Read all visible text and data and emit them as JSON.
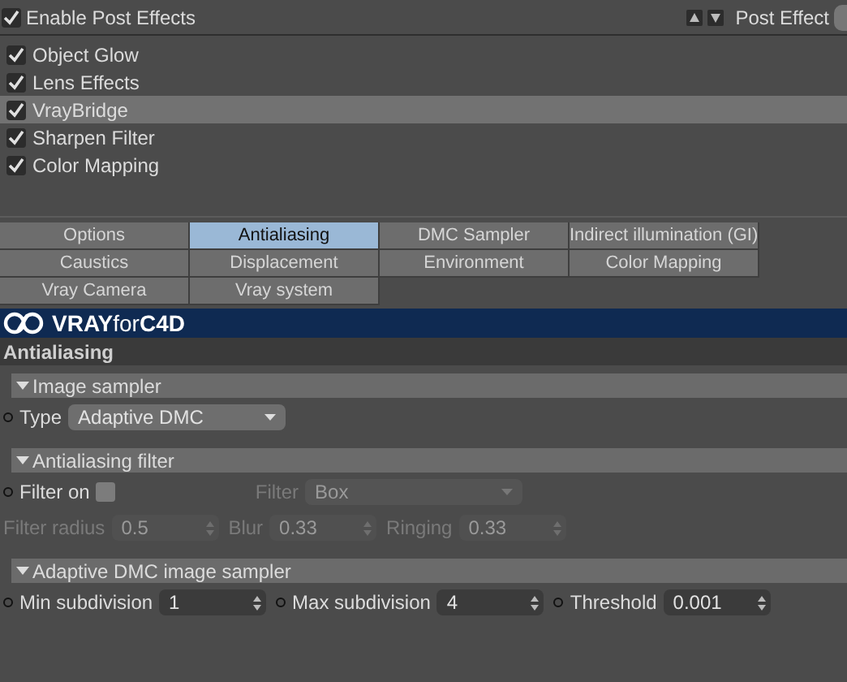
{
  "top_bar": {
    "enable_label": "Enable Post Effects",
    "enable_checked": true,
    "post_effect_label": "Post Effect"
  },
  "effects": [
    {
      "label": "Object Glow",
      "checked": true,
      "selected": false
    },
    {
      "label": "Lens Effects",
      "checked": true,
      "selected": false
    },
    {
      "label": "VrayBridge",
      "checked": true,
      "selected": true
    },
    {
      "label": "Sharpen Filter",
      "checked": true,
      "selected": false
    },
    {
      "label": "Color Mapping",
      "checked": true,
      "selected": false
    }
  ],
  "tabs": [
    {
      "label": "Options",
      "selected": false
    },
    {
      "label": "Antialiasing",
      "selected": true
    },
    {
      "label": "DMC Sampler",
      "selected": false
    },
    {
      "label": "Indirect illumination (GI)",
      "selected": false
    },
    {
      "label": "Caustics",
      "selected": false
    },
    {
      "label": "Displacement",
      "selected": false
    },
    {
      "label": "Environment",
      "selected": false
    },
    {
      "label": "Color Mapping",
      "selected": false
    },
    {
      "label": "Vray Camera",
      "selected": false
    },
    {
      "label": "Vray system",
      "selected": false
    }
  ],
  "banner": {
    "logo_text": "**VRAY**for**C4D**"
  },
  "panel_title": "Antialiasing",
  "sections": [
    {
      "title": "Image sampler",
      "expanded": true,
      "rows": [
        [
          {
            "kind": "select",
            "label": "Type",
            "value": "Adaptive DMC",
            "disabled": false,
            "bullet": true
          }
        ]
      ]
    },
    {
      "title": "Antialiasing filter",
      "expanded": true,
      "rows": [
        [
          {
            "kind": "checkbox",
            "label": "Filter on",
            "checked": false,
            "disabled": false,
            "bullet": true
          },
          {
            "kind": "select",
            "label": "Filter",
            "value": "Box",
            "disabled": true,
            "bullet": false
          }
        ],
        [
          {
            "kind": "number",
            "label": "Filter radius",
            "value": "0.5",
            "disabled": true,
            "bullet": false
          },
          {
            "kind": "number",
            "label": "Blur",
            "value": "0.33",
            "disabled": true,
            "bullet": false
          },
          {
            "kind": "number",
            "label": "Ringing",
            "value": "0.33",
            "disabled": true,
            "bullet": false
          }
        ]
      ]
    },
    {
      "title": "Adaptive DMC image sampler",
      "expanded": true,
      "rows": [
        [
          {
            "kind": "number",
            "label": "Min subdivision",
            "value": "1",
            "disabled": false,
            "bullet": true
          },
          {
            "kind": "number",
            "label": "Max subdivision",
            "value": "4",
            "disabled": false,
            "bullet": true
          },
          {
            "kind": "number",
            "label": "Threshold",
            "value": "0.001",
            "disabled": false,
            "bullet": true
          }
        ]
      ]
    }
  ]
}
